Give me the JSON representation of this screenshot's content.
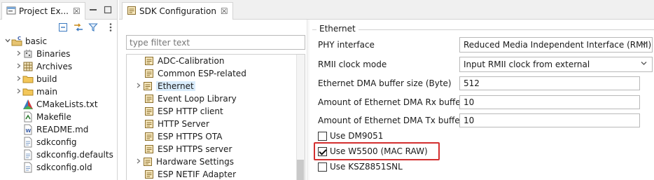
{
  "project_explorer": {
    "tab_title": "Project Ex...",
    "close_glyph": "☒",
    "tree": [
      {
        "label": "basic",
        "icon": "c-project-icon",
        "expanded": true,
        "depth": 0
      },
      {
        "label": "Binaries",
        "icon": "binaries-icon",
        "expanded": false,
        "depth": 1
      },
      {
        "label": "Archives",
        "icon": "archives-icon",
        "expanded": false,
        "depth": 1
      },
      {
        "label": "build",
        "icon": "folder-icon",
        "expanded": false,
        "depth": 1
      },
      {
        "label": "main",
        "icon": "folder-icon",
        "expanded": false,
        "depth": 1
      },
      {
        "label": "CMakeLists.txt",
        "icon": "cmake-icon",
        "depth": 1
      },
      {
        "label": "Makefile",
        "icon": "makefile-icon",
        "depth": 1
      },
      {
        "label": "README.md",
        "icon": "markdown-file-icon",
        "depth": 1
      },
      {
        "label": "sdkconfig",
        "icon": "file-icon",
        "depth": 1
      },
      {
        "label": "sdkconfig.defaults",
        "icon": "file-icon",
        "depth": 1
      },
      {
        "label": "sdkconfig.old",
        "icon": "file-icon",
        "depth": 1
      }
    ]
  },
  "sdk_config": {
    "tab_title": "SDK Configuration",
    "close_glyph": "☒",
    "filter_placeholder": "type filter text",
    "tree": [
      {
        "label": "ADC-Calibration",
        "expandable": false
      },
      {
        "label": "Common ESP-related",
        "expandable": false
      },
      {
        "label": "Ethernet",
        "expandable": true,
        "selected": true
      },
      {
        "label": "Event Loop Library",
        "expandable": false
      },
      {
        "label": "ESP HTTP client",
        "expandable": false
      },
      {
        "label": "HTTP Server",
        "expandable": false
      },
      {
        "label": "ESP HTTPS OTA",
        "expandable": false
      },
      {
        "label": "ESP HTTPS server",
        "expandable": false
      },
      {
        "label": "Hardware Settings",
        "expandable": true
      },
      {
        "label": "ESP NETIF Adapter",
        "expandable": false
      }
    ],
    "group_title": "Ethernet",
    "fields": {
      "phy_interface": {
        "label": "PHY interface",
        "value": "Reduced Media Independent Interface (RMII)"
      },
      "rmii_clock_mode": {
        "label": "RMII clock mode",
        "value": "Input RMII clock from external"
      },
      "dma_buffer_size": {
        "label": "Ethernet DMA buffer size (Byte)",
        "value": "512"
      },
      "dma_rx_buffers": {
        "label": "Amount of Ethernet DMA Rx buffers",
        "value": "10"
      },
      "dma_tx_buffers": {
        "label": "Amount of Ethernet DMA Tx buffers",
        "value": "10"
      }
    },
    "checkboxes": [
      {
        "label": "Use DM9051",
        "checked": false
      },
      {
        "label": "Use W5500 (MAC RAW)",
        "checked": true,
        "highlighted": true
      },
      {
        "label": "Use KSZ8851SNL",
        "checked": false
      }
    ],
    "highlight_color": "#d32f2f",
    "selection_color": "#d9ecfb"
  }
}
